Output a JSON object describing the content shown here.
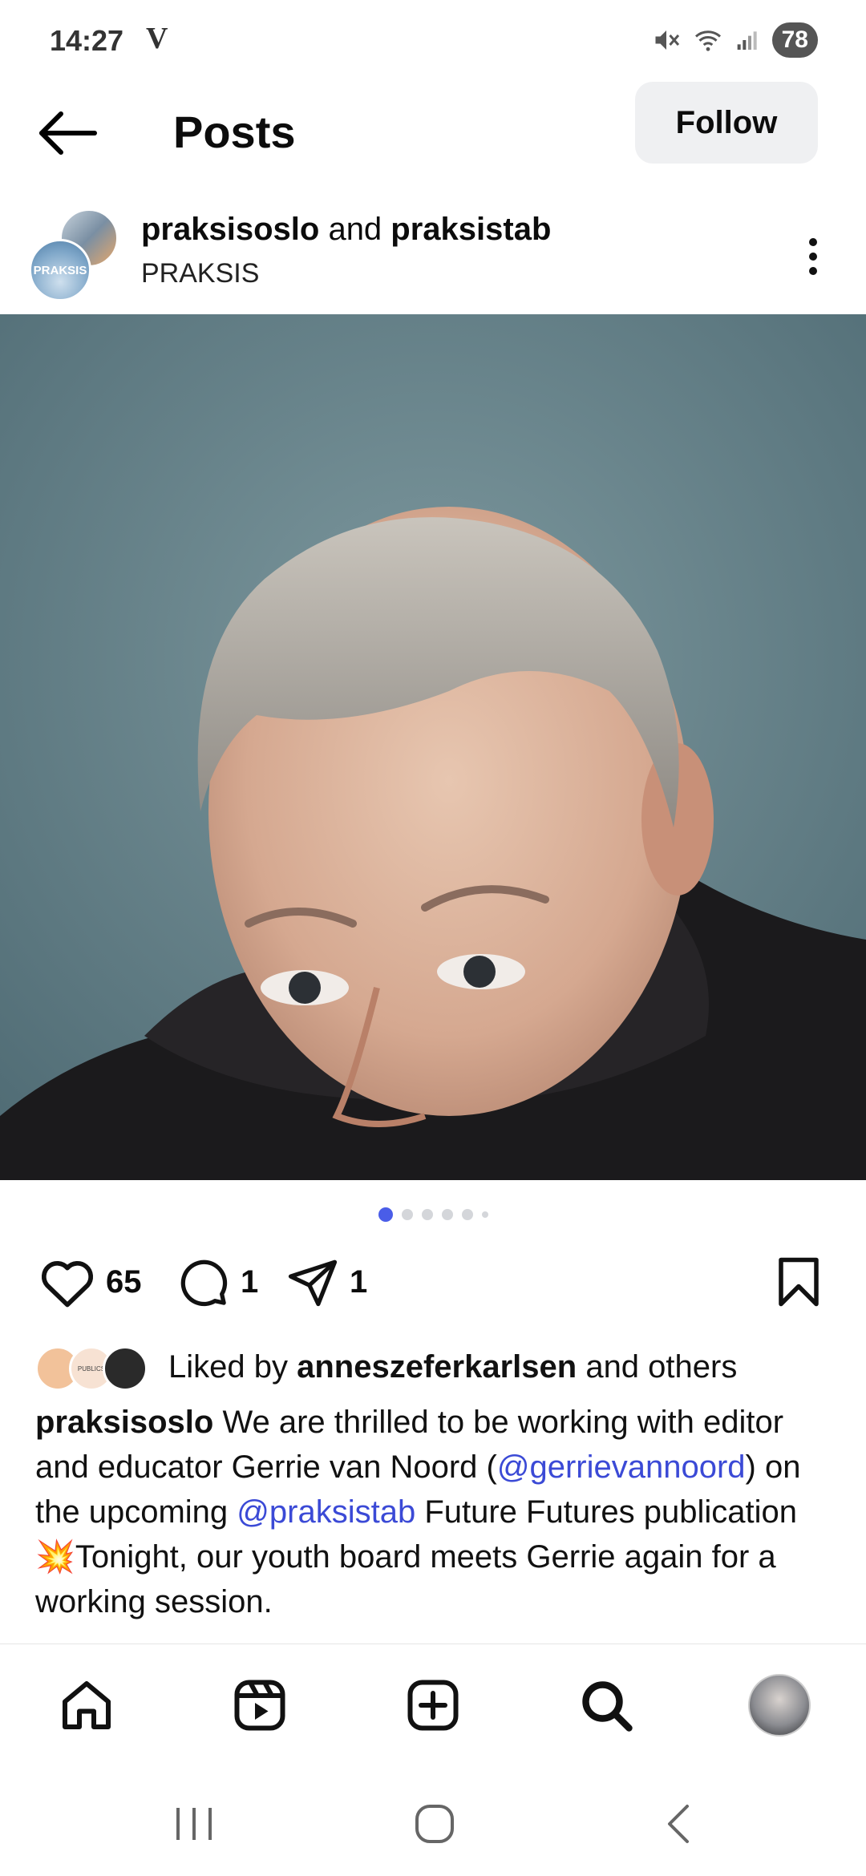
{
  "status_bar": {
    "time": "14:27",
    "carrier": "V",
    "battery": "78"
  },
  "header": {
    "title": "Posts",
    "follow_label": "Follow"
  },
  "post": {
    "author_primary": "praksisoslo",
    "author_joiner": " and ",
    "author_secondary": "praksistab",
    "subtitle": "PRAKSIS",
    "avatar_text": "PRAKSIS"
  },
  "carousel": {
    "total": 6,
    "active_index": 0
  },
  "actions": {
    "likes_count": "65",
    "comments_count": "1",
    "shares_count": "1"
  },
  "likes": {
    "prefix": "Liked by ",
    "user": "anneszeferkarlsen",
    "suffix": " and others",
    "avatar2_text": "PUBLICS"
  },
  "caption": {
    "username": "praksisoslo",
    "text_part1": " We are thrilled to be working with editor and educator Gerrie van Noord (",
    "mention1": "@gerrievannoord",
    "text_part2": ") on the upcoming ",
    "mention2": "@praksistab",
    "text_part3": " Future Futures publication ",
    "emoji": "💥",
    "text_part4": "Tonight, our youth board meets Gerrie again for a working session."
  },
  "bottom_nav": {
    "items": [
      "home-icon",
      "reels-icon",
      "create-icon",
      "search-icon",
      "profile-avatar"
    ]
  },
  "colors": {
    "accent": "#4a5de8",
    "mention": "#3b4ad6",
    "follow_bg": "#eff0f2"
  }
}
